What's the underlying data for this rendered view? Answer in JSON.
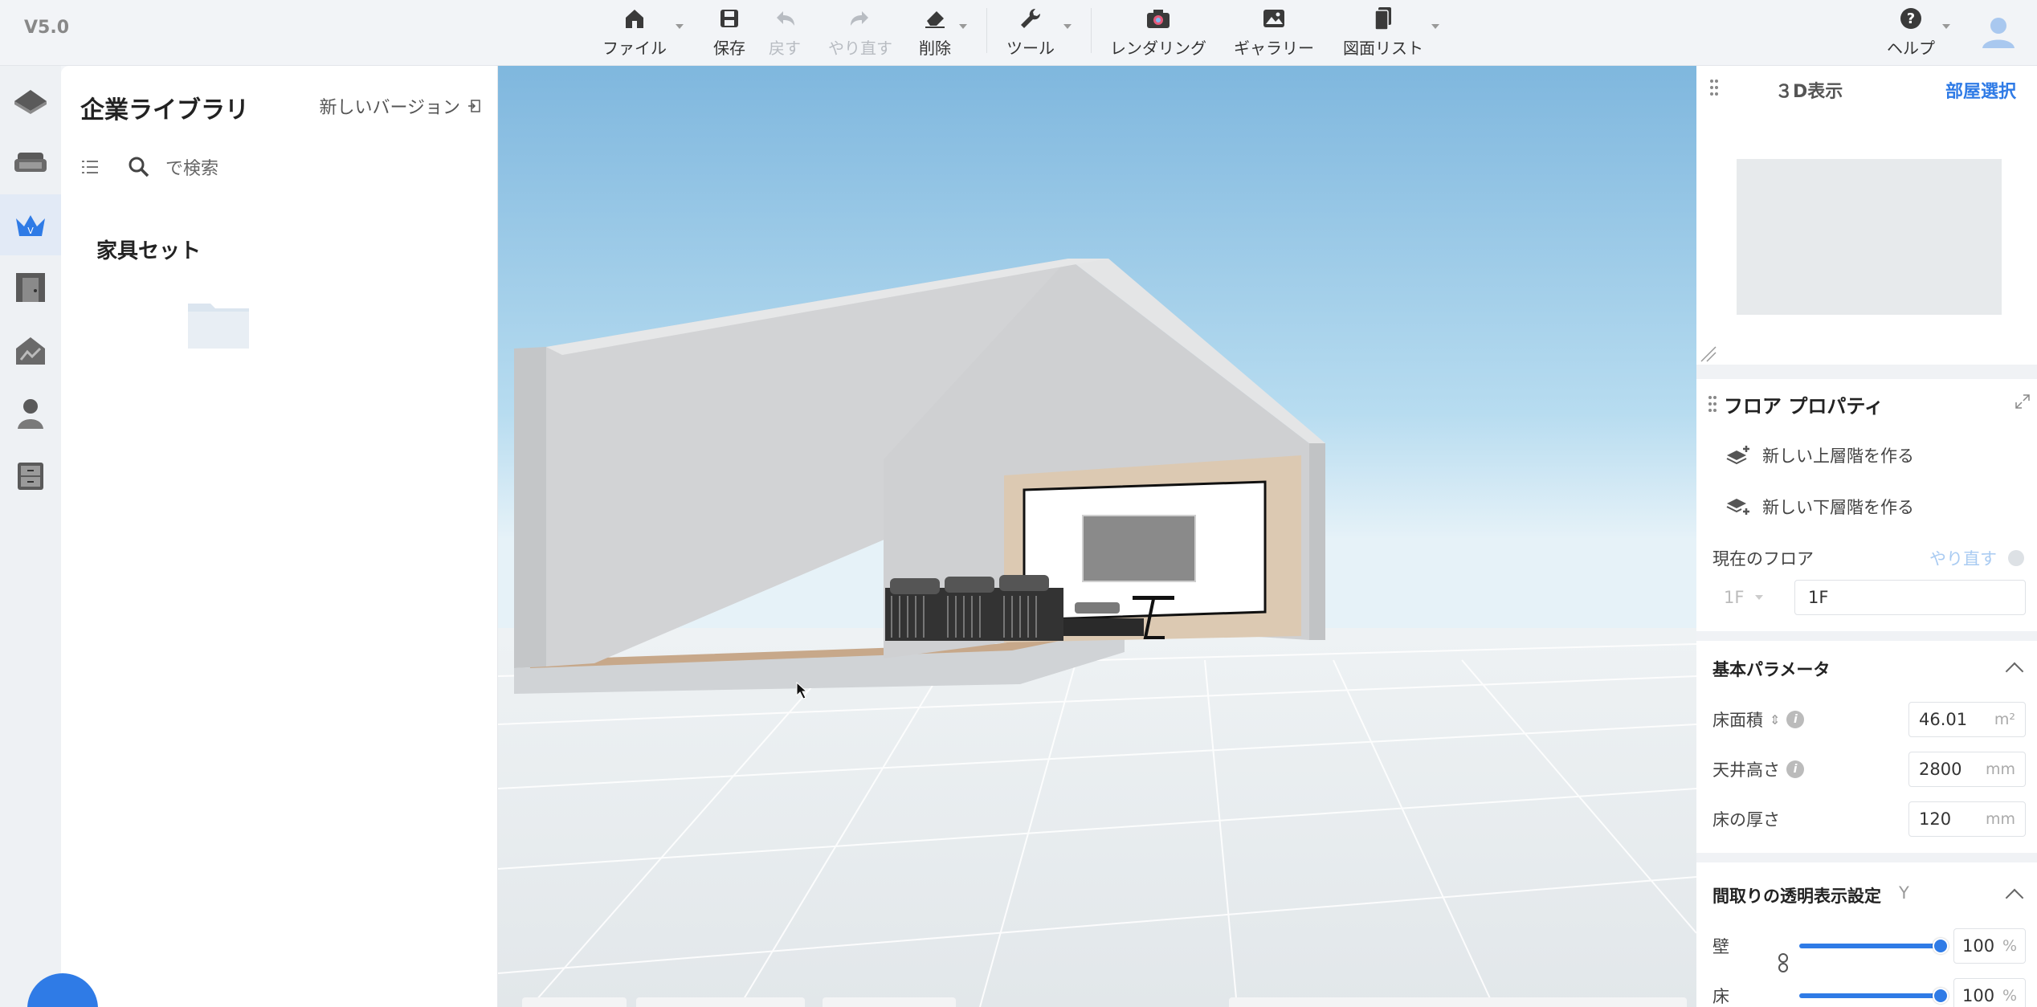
{
  "app": {
    "version": "V5.0"
  },
  "toolbar": {
    "file": "ファイル",
    "save": "保存",
    "undo": "戻す",
    "redo": "やり直す",
    "delete": "削除",
    "tools": "ツール",
    "rendering": "レンダリング",
    "gallery": "ギャラリー",
    "drawing_list": "図面リスト",
    "help": "ヘルプ"
  },
  "rail": {
    "items": [
      "floorplan-icon",
      "sofa-icon",
      "crown-icon",
      "door-icon",
      "house-icon",
      "person-icon",
      "cabinet-icon"
    ],
    "active_index": 2
  },
  "library": {
    "title": "企業ライブラリ",
    "new_version": "新しいバージョン",
    "search_placeholder": "で検索",
    "section": "家具セット"
  },
  "view3d": {
    "title": "３D表示",
    "room_select": "部屋選択"
  },
  "floor_props": {
    "title": "フロア プロパティ",
    "new_upper": "新しい上層階を作る",
    "new_lower": "新しい下層階を作る",
    "current_floor_label": "現在のフロア",
    "redo": "やり直す",
    "floor_select": "1F",
    "floor_name": "1F"
  },
  "basic_params": {
    "title": "基本パラメータ",
    "floor_area_label": "床面積",
    "floor_area_value": "46.01",
    "floor_area_unit": "m²",
    "ceiling_label": "天井高さ",
    "ceiling_value": "2800",
    "ceiling_unit": "mm",
    "floor_thickness_label": "床の厚さ",
    "floor_thickness_value": "120",
    "floor_thickness_unit": "mm"
  },
  "transparency": {
    "title": "間取りの透明表示設定",
    "shortcut": "Y",
    "wall_label": "壁",
    "wall_value": "100",
    "floor_label": "床",
    "floor_value": "100",
    "unit": "%",
    "wall_level": 1.0,
    "floor_level": 1.0
  },
  "colors": {
    "accent": "#2f7be6",
    "sky": "#9ccbe8",
    "ground": "#e9edef"
  }
}
